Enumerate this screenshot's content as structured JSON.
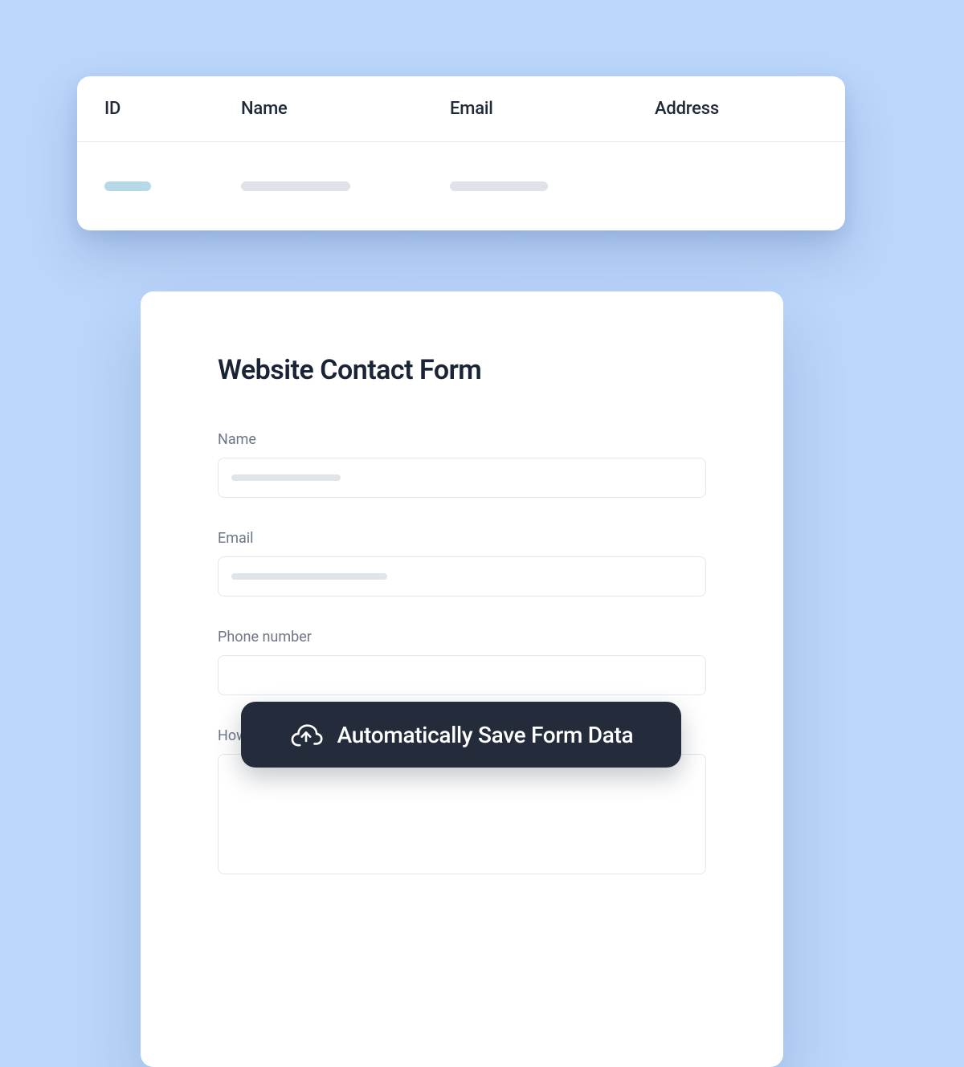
{
  "table": {
    "headers": {
      "id": "ID",
      "name": "Name",
      "email": "Email",
      "address": "Address"
    }
  },
  "form": {
    "title": "Website Contact Form",
    "fields": {
      "name": {
        "label": "Name"
      },
      "email": {
        "label": "Email"
      },
      "phone": {
        "label": "Phone number"
      },
      "how": {
        "label": "How"
      }
    }
  },
  "save_button": {
    "label": "Automatically Save Form Data",
    "icon": "cloud-upload-icon"
  }
}
